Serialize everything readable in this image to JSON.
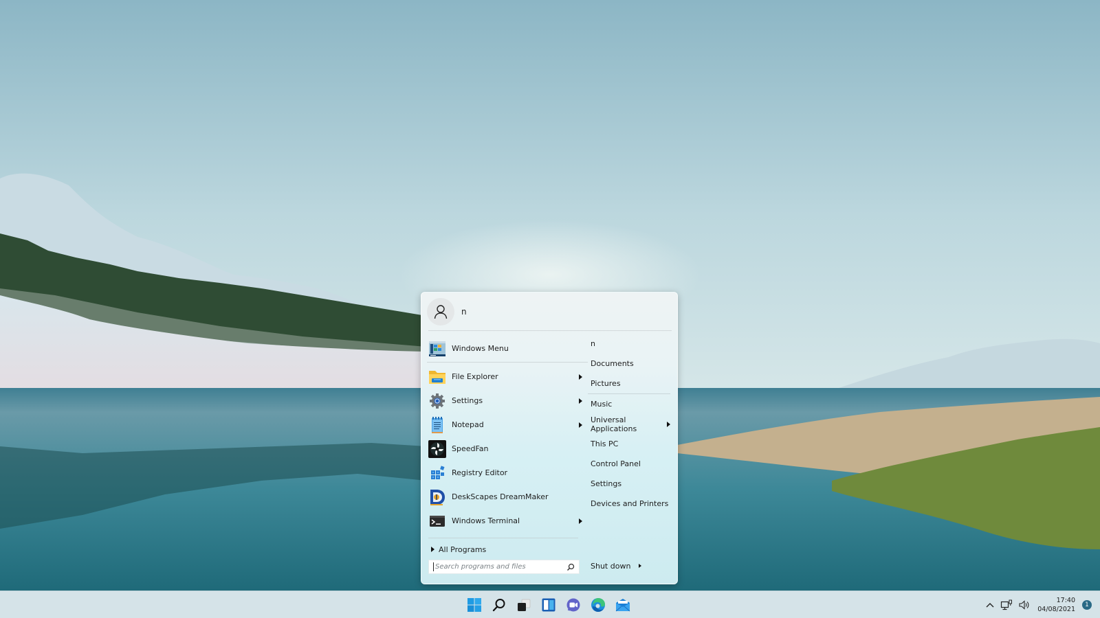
{
  "desktop": {
    "wallpaper": "lakeside landscape with snowy hills, pine forest and grassy shore"
  },
  "start_menu": {
    "user": {
      "name": "n",
      "avatar_icon": "user-icon"
    },
    "pinned": {
      "label": "Windows Menu",
      "icon": "windows-menu-icon"
    },
    "programs": [
      {
        "label": "File Explorer",
        "icon": "folder-icon",
        "has_submenu": true
      },
      {
        "label": "Settings",
        "icon": "gear-icon",
        "has_submenu": true
      },
      {
        "label": "Notepad",
        "icon": "notepad-icon",
        "has_submenu": true
      },
      {
        "label": "SpeedFan",
        "icon": "fan-icon",
        "has_submenu": false
      },
      {
        "label": "Registry Editor",
        "icon": "registry-icon",
        "has_submenu": false
      },
      {
        "label": "DeskScapes DreamMaker",
        "icon": "deskscapes-icon",
        "has_submenu": false
      },
      {
        "label": "Windows Terminal",
        "icon": "terminal-icon",
        "has_submenu": true
      }
    ],
    "all_programs_label": "All Programs",
    "search": {
      "placeholder": "Search programs and files",
      "value": ""
    },
    "places": [
      {
        "label": "n",
        "has_submenu": false
      },
      {
        "label": "Documents",
        "has_submenu": false
      },
      {
        "label": "Pictures",
        "has_submenu": false
      },
      {
        "label": "Music",
        "has_submenu": false
      },
      {
        "label": "Universal Applications",
        "has_submenu": true
      },
      {
        "label": "This PC",
        "has_submenu": false
      },
      {
        "label": "Control Panel",
        "has_submenu": false
      },
      {
        "label": "Settings",
        "has_submenu": false
      },
      {
        "label": "Devices and Printers",
        "has_submenu": false
      }
    ],
    "shutdown_label": "Shut down"
  },
  "taskbar": {
    "apps": [
      {
        "name": "Start",
        "icon": "windows-logo-icon"
      },
      {
        "name": "Search",
        "icon": "search-icon"
      },
      {
        "name": "Task View",
        "icon": "task-view-icon"
      },
      {
        "name": "Widgets",
        "icon": "widgets-icon"
      },
      {
        "name": "Teams Chat",
        "icon": "chat-icon"
      },
      {
        "name": "Microsoft Edge",
        "icon": "edge-icon"
      },
      {
        "name": "Mail",
        "icon": "mail-icon"
      }
    ],
    "tray": {
      "time": "17:40",
      "date": "04/08/2021",
      "notification_count": "1"
    },
    "colors": {
      "accent": "#2a6a86",
      "windows_logo": "#1f9be3"
    }
  }
}
